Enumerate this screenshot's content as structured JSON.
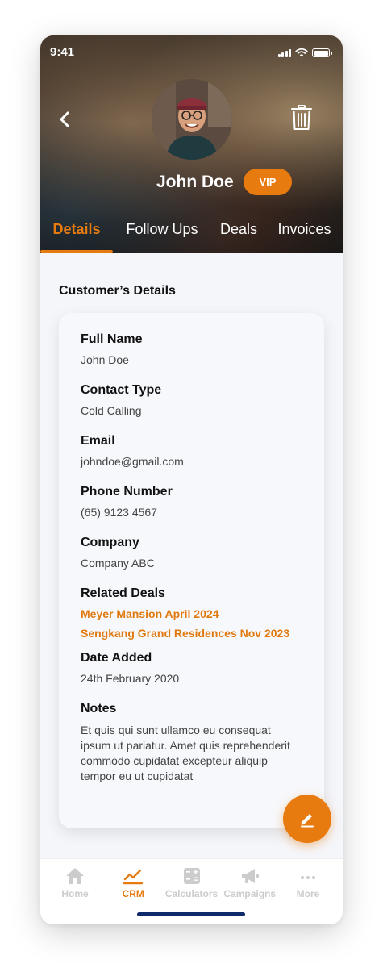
{
  "status_bar": {
    "time": "9:41"
  },
  "header": {
    "name": "John Doe",
    "badge": "VIP"
  },
  "tabs": [
    {
      "label": "Details",
      "active": true
    },
    {
      "label": "Follow Ups",
      "active": false
    },
    {
      "label": "Deals",
      "active": false
    },
    {
      "label": "Invoices",
      "active": false
    }
  ],
  "section_title": "Customer’s Details",
  "details": {
    "full_name": {
      "label": "Full Name",
      "value": "John Doe"
    },
    "contact_type": {
      "label": "Contact Type",
      "value": "Cold Calling"
    },
    "email": {
      "label": "Email",
      "value": "johndoe@gmail.com"
    },
    "phone": {
      "label": "Phone Number",
      "value": "(65) 9123 4567"
    },
    "company": {
      "label": "Company",
      "value": "Company ABC"
    },
    "related_deals": {
      "label": "Related Deals",
      "items": [
        "Meyer Mansion April 2024",
        "Sengkang Grand Residences Nov 2023"
      ]
    },
    "date_added": {
      "label": "Date Added",
      "value": "24th February 2020"
    },
    "notes": {
      "label": "Notes",
      "value": "Et quis qui sunt ullamco eu consequat ipsum ut pariatur. Amet quis reprehenderit commodo cupidatat excepteur aliquip tempor eu ut cupidatat"
    }
  },
  "bottom_nav": [
    {
      "label": "Home",
      "icon": "home-icon",
      "active": false
    },
    {
      "label": "CRM",
      "icon": "chart-line-icon",
      "active": true
    },
    {
      "label": "Calculators",
      "icon": "calculator-icon",
      "active": false
    },
    {
      "label": "Campaigns",
      "icon": "megaphone-icon",
      "active": false
    },
    {
      "label": "More",
      "icon": "more-icon",
      "active": false
    }
  ],
  "colors": {
    "accent": "#e87b10",
    "background": "#f5f6fa",
    "home_indicator": "#0f2a6b"
  }
}
